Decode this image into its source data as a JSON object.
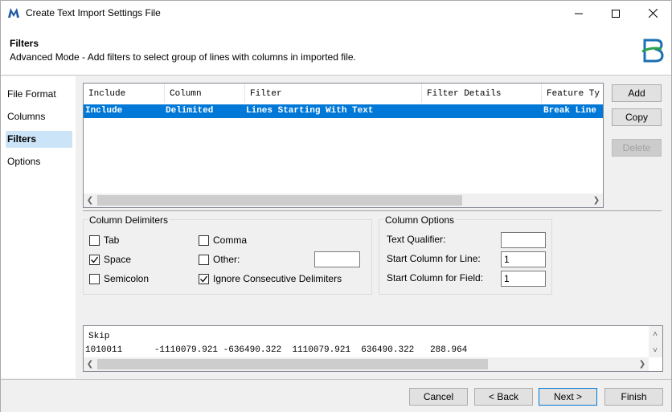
{
  "window": {
    "title": "Create Text Import Settings File"
  },
  "header": {
    "title": "Filters",
    "subtitle": "Advanced Mode - Add filters to select group of lines with columns in imported file."
  },
  "nav": {
    "items": [
      {
        "label": "File Format"
      },
      {
        "label": "Columns"
      },
      {
        "label": "Filters"
      },
      {
        "label": "Options"
      }
    ]
  },
  "grid": {
    "columns": [
      "Include",
      "Column",
      "Filter",
      "Filter Details",
      "Feature Ty"
    ],
    "rows": [
      [
        "Include",
        "Delimited",
        "Lines Starting With Text",
        "",
        "Break Line"
      ]
    ]
  },
  "buttons": {
    "add": "Add",
    "copy": "Copy",
    "delete": "Delete"
  },
  "delimiters": {
    "title": "Column Delimiters",
    "tab": {
      "label": "Tab",
      "checked": false
    },
    "space": {
      "label": "Space",
      "checked": true
    },
    "semicolon": {
      "label": "Semicolon",
      "checked": false
    },
    "comma": {
      "label": "Comma",
      "checked": false
    },
    "other": {
      "label": "Other:",
      "checked": false,
      "value": ""
    },
    "ignore": {
      "label": "Ignore Consecutive Delimiters",
      "checked": true
    }
  },
  "column_options": {
    "title": "Column Options",
    "text_qualifier": {
      "label": "Text Qualifier:",
      "value": ""
    },
    "start_line": {
      "label": "Start Column for Line:",
      "value": "1"
    },
    "start_field": {
      "label": "Start Column for Field:",
      "value": "1"
    }
  },
  "preview": {
    "lines": [
      "Skip",
      "1010011      -1110079.921 -636490.322  1110079.921  636490.322   288.964"
    ]
  },
  "footer": {
    "cancel": "Cancel",
    "back": "< Back",
    "next": "Next >",
    "finish": "Finish"
  }
}
